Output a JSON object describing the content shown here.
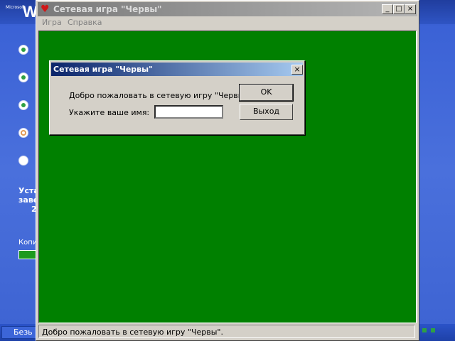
{
  "background": {
    "logo_small": "Microsoft",
    "logo_letter": "W",
    "install_line1": "Уста",
    "install_line2": "заве",
    "install_line3": "2",
    "copy_label": "Копи",
    "taskbar_item": "Безь",
    "step_states": [
      "done",
      "done",
      "done",
      "current",
      "pending"
    ]
  },
  "window": {
    "title": "Сетевая игра \"Червы\"",
    "title_icon": "heart-icon",
    "buttons": {
      "minimize": "_",
      "maximize": "□",
      "close": "×"
    },
    "menu": [
      "Игра",
      "Справка"
    ],
    "status_text": "Добро пожаловать в сетевую игру \"Червы\".",
    "felt_color": "#008000"
  },
  "dialog": {
    "title": "Сетевая игра \"Червы\"",
    "close": "×",
    "message": "Добро пожаловать в сетевую игру \"Червы\".",
    "name_label": "Укажите ваше имя:",
    "name_value": "",
    "ok_label": "OK",
    "exit_label": "Выход"
  }
}
